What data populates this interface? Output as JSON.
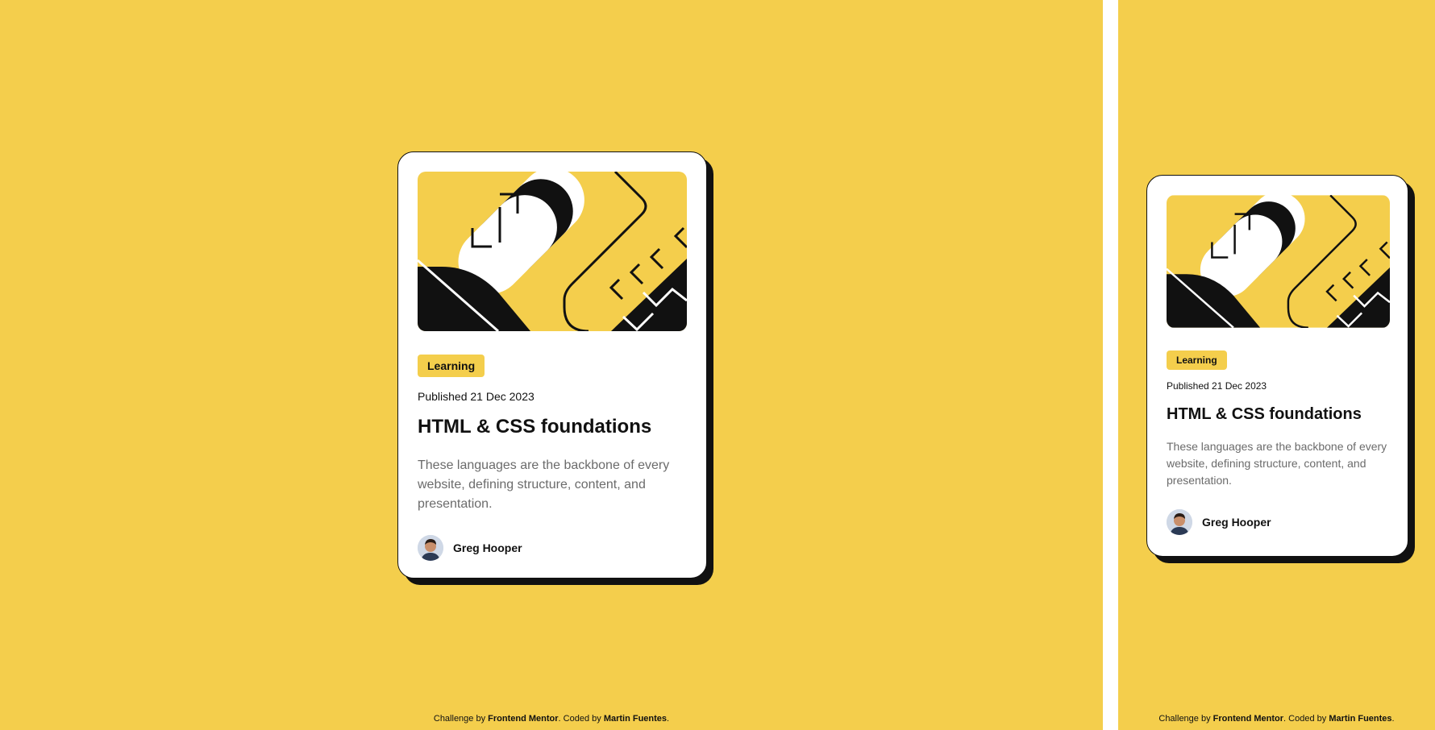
{
  "colors": {
    "background": "#F4CE4C",
    "card": "#FFFFFF",
    "ink": "#111111",
    "muted_text": "#6B6B6B"
  },
  "card": {
    "tag": "Learning",
    "published": "Published 21 Dec 2023",
    "title": "HTML & CSS foundations",
    "description": "These languages are the backbone of every website, defining structure, content, and presentation.",
    "author": "Greg Hooper",
    "hero_icon": "abstract-illustration",
    "avatar_icon": "author-avatar"
  },
  "footer": {
    "prefix": "Challenge by ",
    "challenge_link": "Frontend Mentor",
    "middle": ". Coded by ",
    "author_link": "Martin Fuentes",
    "suffix": "."
  }
}
